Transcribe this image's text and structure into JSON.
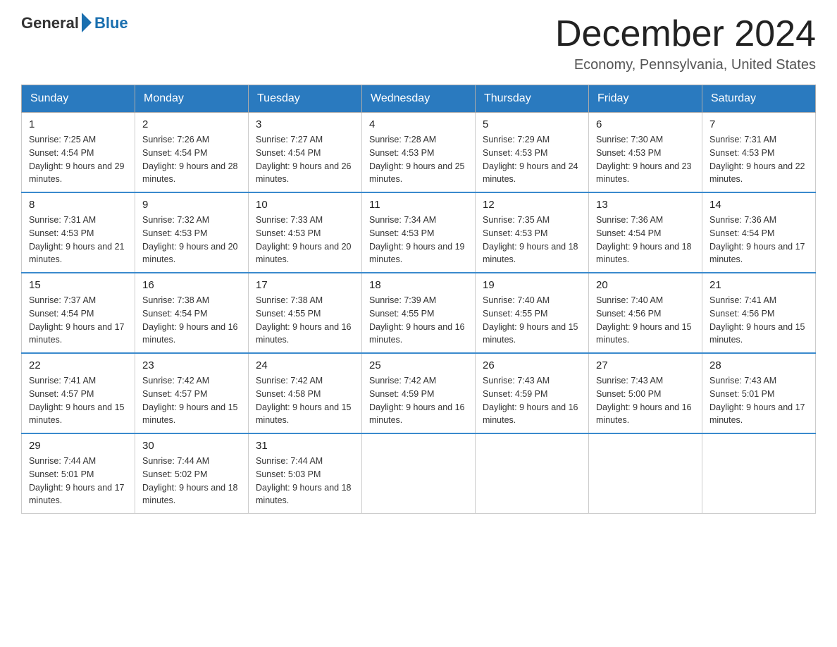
{
  "header": {
    "logo_general": "General",
    "logo_blue": "Blue",
    "month_title": "December 2024",
    "location": "Economy, Pennsylvania, United States"
  },
  "weekdays": [
    "Sunday",
    "Monday",
    "Tuesday",
    "Wednesday",
    "Thursday",
    "Friday",
    "Saturday"
  ],
  "weeks": [
    [
      {
        "day": "1",
        "sunrise": "7:25 AM",
        "sunset": "4:54 PM",
        "daylight": "9 hours and 29 minutes."
      },
      {
        "day": "2",
        "sunrise": "7:26 AM",
        "sunset": "4:54 PM",
        "daylight": "9 hours and 28 minutes."
      },
      {
        "day": "3",
        "sunrise": "7:27 AM",
        "sunset": "4:54 PM",
        "daylight": "9 hours and 26 minutes."
      },
      {
        "day": "4",
        "sunrise": "7:28 AM",
        "sunset": "4:53 PM",
        "daylight": "9 hours and 25 minutes."
      },
      {
        "day": "5",
        "sunrise": "7:29 AM",
        "sunset": "4:53 PM",
        "daylight": "9 hours and 24 minutes."
      },
      {
        "day": "6",
        "sunrise": "7:30 AM",
        "sunset": "4:53 PM",
        "daylight": "9 hours and 23 minutes."
      },
      {
        "day": "7",
        "sunrise": "7:31 AM",
        "sunset": "4:53 PM",
        "daylight": "9 hours and 22 minutes."
      }
    ],
    [
      {
        "day": "8",
        "sunrise": "7:31 AM",
        "sunset": "4:53 PM",
        "daylight": "9 hours and 21 minutes."
      },
      {
        "day": "9",
        "sunrise": "7:32 AM",
        "sunset": "4:53 PM",
        "daylight": "9 hours and 20 minutes."
      },
      {
        "day": "10",
        "sunrise": "7:33 AM",
        "sunset": "4:53 PM",
        "daylight": "9 hours and 20 minutes."
      },
      {
        "day": "11",
        "sunrise": "7:34 AM",
        "sunset": "4:53 PM",
        "daylight": "9 hours and 19 minutes."
      },
      {
        "day": "12",
        "sunrise": "7:35 AM",
        "sunset": "4:53 PM",
        "daylight": "9 hours and 18 minutes."
      },
      {
        "day": "13",
        "sunrise": "7:36 AM",
        "sunset": "4:54 PM",
        "daylight": "9 hours and 18 minutes."
      },
      {
        "day": "14",
        "sunrise": "7:36 AM",
        "sunset": "4:54 PM",
        "daylight": "9 hours and 17 minutes."
      }
    ],
    [
      {
        "day": "15",
        "sunrise": "7:37 AM",
        "sunset": "4:54 PM",
        "daylight": "9 hours and 17 minutes."
      },
      {
        "day": "16",
        "sunrise": "7:38 AM",
        "sunset": "4:54 PM",
        "daylight": "9 hours and 16 minutes."
      },
      {
        "day": "17",
        "sunrise": "7:38 AM",
        "sunset": "4:55 PM",
        "daylight": "9 hours and 16 minutes."
      },
      {
        "day": "18",
        "sunrise": "7:39 AM",
        "sunset": "4:55 PM",
        "daylight": "9 hours and 16 minutes."
      },
      {
        "day": "19",
        "sunrise": "7:40 AM",
        "sunset": "4:55 PM",
        "daylight": "9 hours and 15 minutes."
      },
      {
        "day": "20",
        "sunrise": "7:40 AM",
        "sunset": "4:56 PM",
        "daylight": "9 hours and 15 minutes."
      },
      {
        "day": "21",
        "sunrise": "7:41 AM",
        "sunset": "4:56 PM",
        "daylight": "9 hours and 15 minutes."
      }
    ],
    [
      {
        "day": "22",
        "sunrise": "7:41 AM",
        "sunset": "4:57 PM",
        "daylight": "9 hours and 15 minutes."
      },
      {
        "day": "23",
        "sunrise": "7:42 AM",
        "sunset": "4:57 PM",
        "daylight": "9 hours and 15 minutes."
      },
      {
        "day": "24",
        "sunrise": "7:42 AM",
        "sunset": "4:58 PM",
        "daylight": "9 hours and 15 minutes."
      },
      {
        "day": "25",
        "sunrise": "7:42 AM",
        "sunset": "4:59 PM",
        "daylight": "9 hours and 16 minutes."
      },
      {
        "day": "26",
        "sunrise": "7:43 AM",
        "sunset": "4:59 PM",
        "daylight": "9 hours and 16 minutes."
      },
      {
        "day": "27",
        "sunrise": "7:43 AM",
        "sunset": "5:00 PM",
        "daylight": "9 hours and 16 minutes."
      },
      {
        "day": "28",
        "sunrise": "7:43 AM",
        "sunset": "5:01 PM",
        "daylight": "9 hours and 17 minutes."
      }
    ],
    [
      {
        "day": "29",
        "sunrise": "7:44 AM",
        "sunset": "5:01 PM",
        "daylight": "9 hours and 17 minutes."
      },
      {
        "day": "30",
        "sunrise": "7:44 AM",
        "sunset": "5:02 PM",
        "daylight": "9 hours and 18 minutes."
      },
      {
        "day": "31",
        "sunrise": "7:44 AM",
        "sunset": "5:03 PM",
        "daylight": "9 hours and 18 minutes."
      },
      null,
      null,
      null,
      null
    ]
  ]
}
